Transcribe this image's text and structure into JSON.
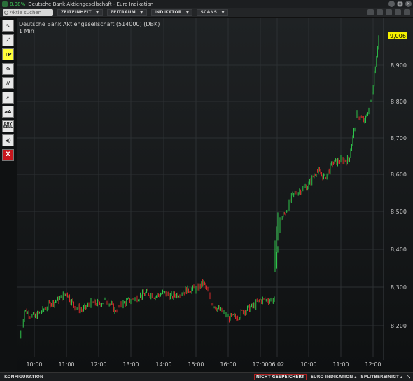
{
  "window": {
    "change_pct": "8,08%",
    "title": "Deutsche Bank Aktiengesellschaft - Euro Indikation"
  },
  "toolbar": {
    "search_placeholder": "Aktie suchen",
    "menus": [
      {
        "label": "ZEITEINHEIT"
      },
      {
        "label": "ZEITRAUM"
      },
      {
        "label": "INDIKATOR"
      },
      {
        "label": "SCANS"
      }
    ]
  },
  "tools": [
    {
      "name": "cursor-tool",
      "label": "",
      "icon": "arrow-cursor-icon"
    },
    {
      "name": "line-tool",
      "label": "",
      "icon": "trend-line-icon"
    },
    {
      "name": "tp-tool",
      "label": "TP",
      "icon": ""
    },
    {
      "name": "fibonacci-tool",
      "label": "",
      "icon": "percent-lines-icon"
    },
    {
      "name": "channel-tool",
      "label": "",
      "icon": "parallel-lines-icon"
    },
    {
      "name": "zoom-tool",
      "label": "",
      "icon": "magnifier-icon"
    },
    {
      "name": "text-tool",
      "label": "aA",
      "icon": ""
    },
    {
      "name": "buy-sell-tool",
      "label": "BUY SELL",
      "icon": ""
    },
    {
      "name": "sound-tool",
      "label": "",
      "icon": "speaker-icon"
    },
    {
      "name": "remove-tool",
      "label": "X",
      "icon": ""
    }
  ],
  "chart": {
    "instrument": "Deutsche Bank Aktiengesellschaft (514000) (DBK)",
    "interval": "1 Min",
    "last_price": "9,006",
    "colors": {
      "up": "#2ec34a",
      "down": "#d32a2a",
      "grid": "#2c3033",
      "price_tag": "#f5f000"
    }
  },
  "chart_data": {
    "type": "line",
    "yaxis_ticks": [
      "8,900",
      "8,800",
      "8,700",
      "8,600",
      "8,500",
      "8,400",
      "8,300",
      "8,200"
    ],
    "xaxis_ticks": [
      "10:00",
      "11:00",
      "12:00",
      "13:00",
      "14:00",
      "15:00",
      "16:00",
      "17:00",
      "06.02.",
      "10:00",
      "11:00",
      "12:00"
    ],
    "ylim": [
      8.11,
      9.03
    ],
    "x": [
      "09:40",
      "09:50",
      "10:00",
      "10:15",
      "10:30",
      "10:45",
      "11:00",
      "11:15",
      "11:30",
      "11:45",
      "12:00",
      "12:15",
      "12:30",
      "12:45",
      "13:00",
      "13:15",
      "13:30",
      "13:45",
      "14:00",
      "14:15",
      "14:30",
      "14:45",
      "15:00",
      "15:15",
      "15:30",
      "15:45",
      "16:00",
      "16:15",
      "16:30",
      "16:45",
      "17:00",
      "17:15",
      "17:25",
      "06.02. 09:00",
      "09:15",
      "09:30",
      "09:45",
      "10:00",
      "10:15",
      "10:30",
      "10:45",
      "11:00",
      "11:15",
      "11:30",
      "11:45",
      "12:00",
      "12:10"
    ],
    "values": [
      8.14,
      8.22,
      8.2,
      8.22,
      8.24,
      8.25,
      8.27,
      8.23,
      8.22,
      8.24,
      8.24,
      8.25,
      8.22,
      8.24,
      8.25,
      8.26,
      8.27,
      8.26,
      8.27,
      8.26,
      8.27,
      8.28,
      8.28,
      8.3,
      8.24,
      8.22,
      8.2,
      8.2,
      8.22,
      8.23,
      8.25,
      8.25,
      8.25,
      8.34,
      8.48,
      8.5,
      8.55,
      8.58,
      8.62,
      8.6,
      8.64,
      8.65,
      8.65,
      8.78,
      8.76,
      8.82,
      9.006
    ]
  },
  "statusbar": {
    "left": "KONFIGURATION",
    "not_saved": "NICHT GESPEICHERT",
    "euro_indication": "EURO INDIKATION ▴",
    "split": "SPLITBEREINIGT ▴"
  }
}
